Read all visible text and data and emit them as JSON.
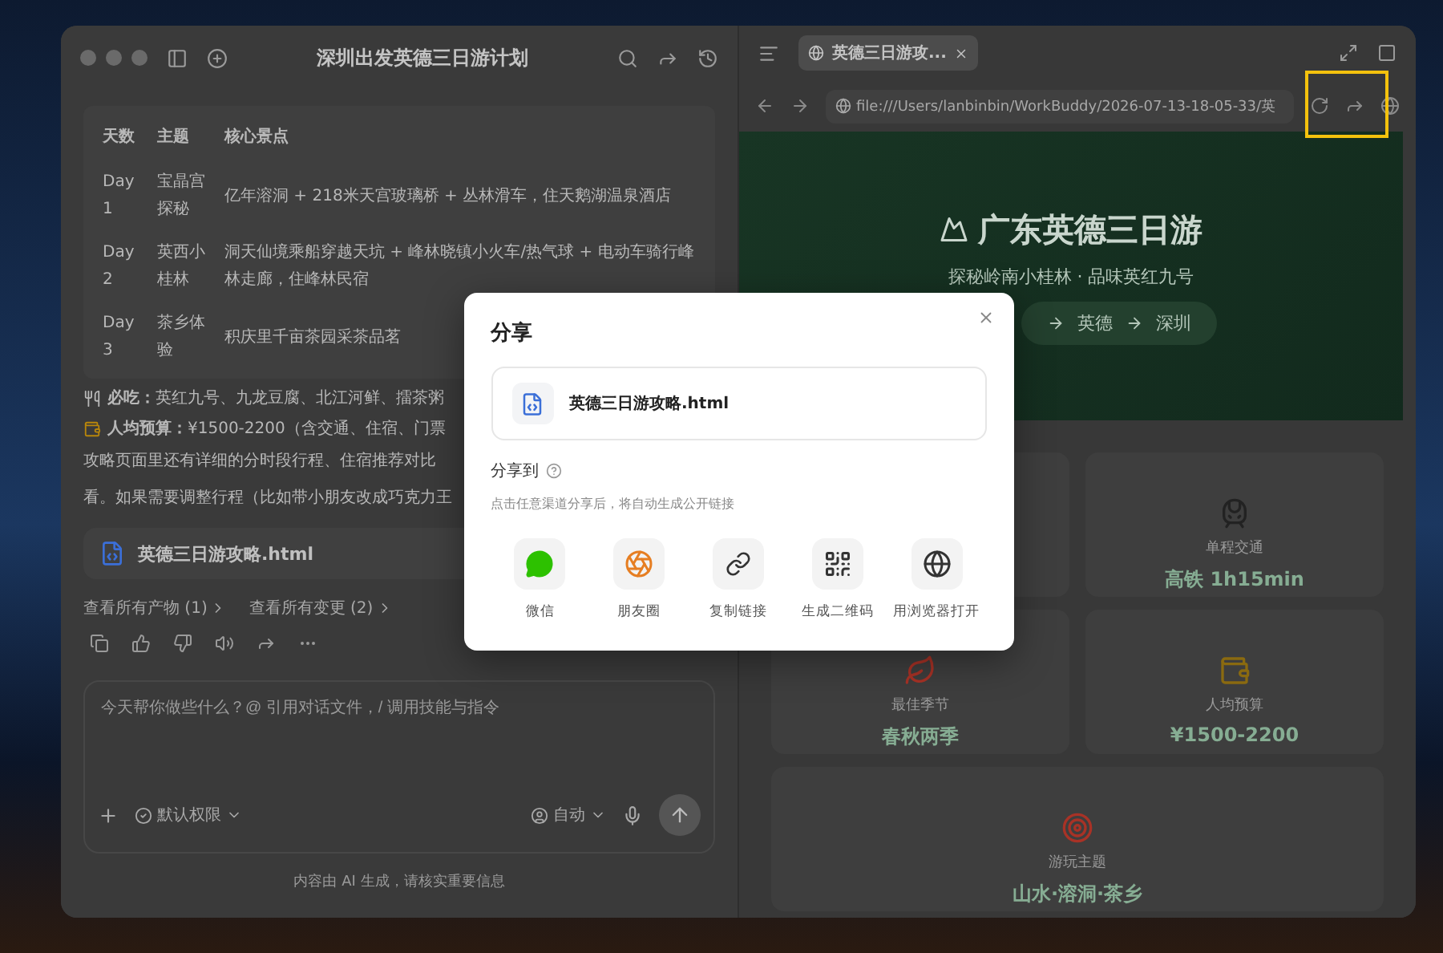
{
  "left_pane": {
    "title": "深圳出发英德三日游计划",
    "table": {
      "columns": [
        "天数",
        "主题",
        "核心景点"
      ],
      "rows": [
        [
          "Day 1",
          "宝晶宫探秘",
          "亿年溶洞 + 218米天宫玻璃桥 + 丛林滑车，住天鹅湖温泉酒店"
        ],
        [
          "Day 2",
          "英西小桂林",
          "洞天仙境乘船穿越天坑 + 峰林晓镇小火车/热气球 + 电动车骑行峰林走廊，住峰林民宿"
        ],
        [
          "Day 3",
          "茶乡体验",
          "积庆里千亩茶园采茶品茗"
        ]
      ]
    },
    "notes": [
      {
        "kind": "food",
        "text": "**必吃：**英红九号、九龙豆腐、北江河鲜、擂茶粥"
      },
      {
        "kind": "money",
        "text": "**人均预算：**¥1500-2200（含交通、住宿、门票"
      }
    ],
    "paragraph": [
      "攻略页面里还有详细的分时段行程、住宿推荐对比",
      "看。如果需要调整行程（比如带小朋友改成巧克力王"
    ],
    "attachment": "英德三日游攻略.html",
    "links": [
      "查看所有产物 (1)",
      "查看所有变更 (2)"
    ],
    "composer": {
      "placeholder": "今天帮你做些什么？@ 引用对话文件，/ 调用技能与指令",
      "permission": "默认权限",
      "mode": "自动"
    },
    "footer": "内容由 AI 生成，请核实重要信息"
  },
  "right_pane": {
    "tab": {
      "label": "英德三日游攻...",
      "selected": true
    },
    "address": "file:///Users/lanbinbin/WorkBuddy/2026-07-13-18-05-33/英",
    "hero": {
      "title": "广东英德三日游",
      "subtitle": "探秘岭南小桂林 · 品味英红九号",
      "route": [
        "英德",
        "深圳"
      ]
    },
    "cards": [
      {
        "kind": "train",
        "label": "单程交通",
        "value": "高铁 1h15min"
      },
      {
        "kind": "season",
        "label": "最佳季节",
        "value": "春秋两季"
      },
      {
        "kind": "money",
        "label": "人均预算",
        "value": "¥1500-2200"
      },
      {
        "kind": "target",
        "label": "游玩主题",
        "value": "山水·溶洞·茶乡"
      }
    ]
  },
  "share_dialog": {
    "title": "分享",
    "file": "英德三日游攻略.html",
    "share_label": "分享到",
    "hint": "点击任意渠道分享后，将自动生成公开链接",
    "options": [
      {
        "kind": "wechat",
        "label": "微信"
      },
      {
        "kind": "moments",
        "label": "朋友圈"
      },
      {
        "kind": "link",
        "label": "复制链接"
      },
      {
        "kind": "qr",
        "label": "生成二维码"
      },
      {
        "kind": "browser",
        "label": "用浏览器打开"
      }
    ]
  }
}
